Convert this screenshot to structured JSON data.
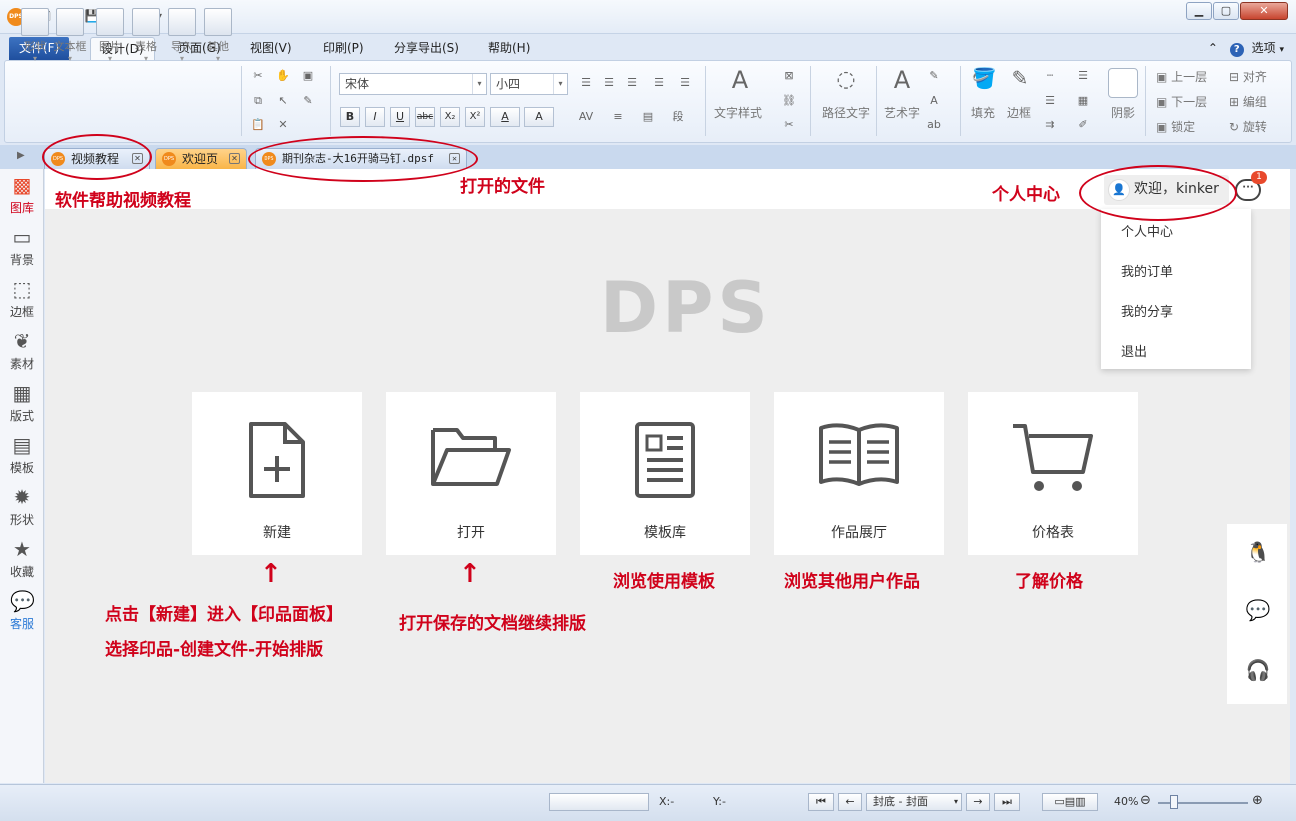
{
  "app": {
    "logo_text": "DPS"
  },
  "window_controls": {
    "minimize": "▁",
    "maximize": "▢",
    "close": "✕"
  },
  "quick_access": {
    "new": "🗋",
    "open": "📂",
    "save": "💾",
    "undo": "↶",
    "redo": "↷",
    "more": "▾"
  },
  "menu": {
    "items": [
      "文件(F)",
      "设计(D)",
      "页面(G)",
      "视图(V)",
      "印刷(P)",
      "分享导出(S)",
      "帮助(H)"
    ],
    "options_label": "选项",
    "help_glyph": "?",
    "collapse_glyph": "⌃"
  },
  "ribbon": {
    "insert_buttons": [
      "形状",
      "文本框",
      "图片",
      "表格",
      "导入",
      "其他"
    ],
    "font_name": "宋体",
    "font_size": "小四",
    "format_buttons": [
      "B",
      "I",
      "U",
      "abc",
      "X₂",
      "X²",
      "A",
      "A"
    ],
    "text_style": "文字样式",
    "path_text": "路径文字",
    "art_text": "艺术字",
    "fill": "填充",
    "border": "边框",
    "shadow": "阴影",
    "arrange": [
      "上一层",
      "下一层",
      "锁定",
      "对齐",
      "编组",
      "旋转"
    ]
  },
  "tabs": [
    {
      "label": "视频教程",
      "style": "blue"
    },
    {
      "label": "欢迎页",
      "style": "orange"
    },
    {
      "label": "期刊杂志-大16开骑马钉.dpsf",
      "style": "blue"
    }
  ],
  "tab_close_glyph": "✕",
  "left_toolbar": [
    {
      "label": "图库",
      "icon": "gallery-icon"
    },
    {
      "label": "背景",
      "icon": "background-icon"
    },
    {
      "label": "边框",
      "icon": "border-icon"
    },
    {
      "label": "素材",
      "icon": "material-icon"
    },
    {
      "label": "版式",
      "icon": "layout-icon"
    },
    {
      "label": "模板",
      "icon": "template-icon"
    },
    {
      "label": "形状",
      "icon": "shape-icon"
    },
    {
      "label": "收藏",
      "icon": "favorite-icon"
    },
    {
      "label": "客服",
      "icon": "service-icon"
    }
  ],
  "main": {
    "brand": "DPS",
    "user_greeting": "欢迎，kinker",
    "message_badge": "1",
    "user_menu": [
      "个人中心",
      "我的订单",
      "我的分享",
      "退出"
    ],
    "cards": [
      {
        "label": "新建",
        "icon": "new-file-icon"
      },
      {
        "label": "打开",
        "icon": "folder-icon"
      },
      {
        "label": "模板库",
        "icon": "template-doc-icon"
      },
      {
        "label": "作品展厅",
        "icon": "book-icon"
      },
      {
        "label": "价格表",
        "icon": "cart-icon"
      }
    ],
    "side_icons": [
      "qq-icon",
      "wechat-icon",
      "support-icon"
    ]
  },
  "annotations": {
    "video_help": "软件帮助视频教程",
    "opened_file": "打开的文件",
    "personal_center": "个人中心",
    "new_line1": "点击【新建】进入【印品面板】",
    "new_line2": "选择印品-创建文件-开始排版",
    "open_saved": "打开保存的文档继续排版",
    "browse_templates": "浏览使用模板",
    "browse_works": "浏览其他用户作品",
    "price": "了解价格",
    "arrow_glyph": "↑"
  },
  "statusbar": {
    "x_label": "X:-",
    "y_label": "Y:-",
    "page_label": "封底 - 封面",
    "zoom": "40%"
  },
  "colors": {
    "accent_red": "#d0021b",
    "brand_orange": "#f08a1c",
    "menu_blue": "#1f4f9e"
  }
}
